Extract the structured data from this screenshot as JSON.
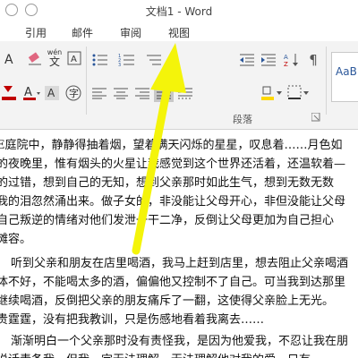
{
  "window": {
    "title": "文档1 - Word"
  },
  "tabs": [
    "引用",
    "邮件",
    "审阅",
    "视图"
  ],
  "ribbon": {
    "phonetic_label": "wén",
    "group_label": "段落",
    "styles_preview": "AaB"
  },
  "document": {
    "lines": [
      "E庭院中，静静得抽着烟，望着满天闪烁的星星，叹息着……月色如",
      "的夜晚里，惟有烟头的火星让我感觉到这个世界还活着，还温软着—",
      "的过错，想到自己的无知，想到父亲那时如此生气，想到无数无数",
      "我的泪忽然涌出来。做子女的，非没能让父母开心，非但没能让父母",
      "自己叛逆的情绪对他们发泄一干二净，反倒让父母更加为自己担心",
      "摊容。",
      "听到父亲和朋友在店里喝酒，我马上赶到店里，想去阻止父亲喝酒",
      "体不好，不能喝太多的酒，偏偏他又控制不了自己。可当我到达那里",
      "继续喝酒，反倒把父亲的朋友痛斥了一翻，这使得父亲脸上无光。",
      "贵霆霆，没有把我教训，只是伤感地看着我离去……",
      "渐渐明白一个父亲那时没有责怪我，是因为他爱我，不忍让我在朋",
      "说话责备我，但我一定无法理解。无法理解他对我的爱，只有"
    ]
  },
  "colors": {
    "arrow": "#f4f40a",
    "ribbon_bg": "#f3f3f3",
    "accent": "#2b579a",
    "font_color_red": "#c00000",
    "highlight_yellow": "#ffd800"
  }
}
